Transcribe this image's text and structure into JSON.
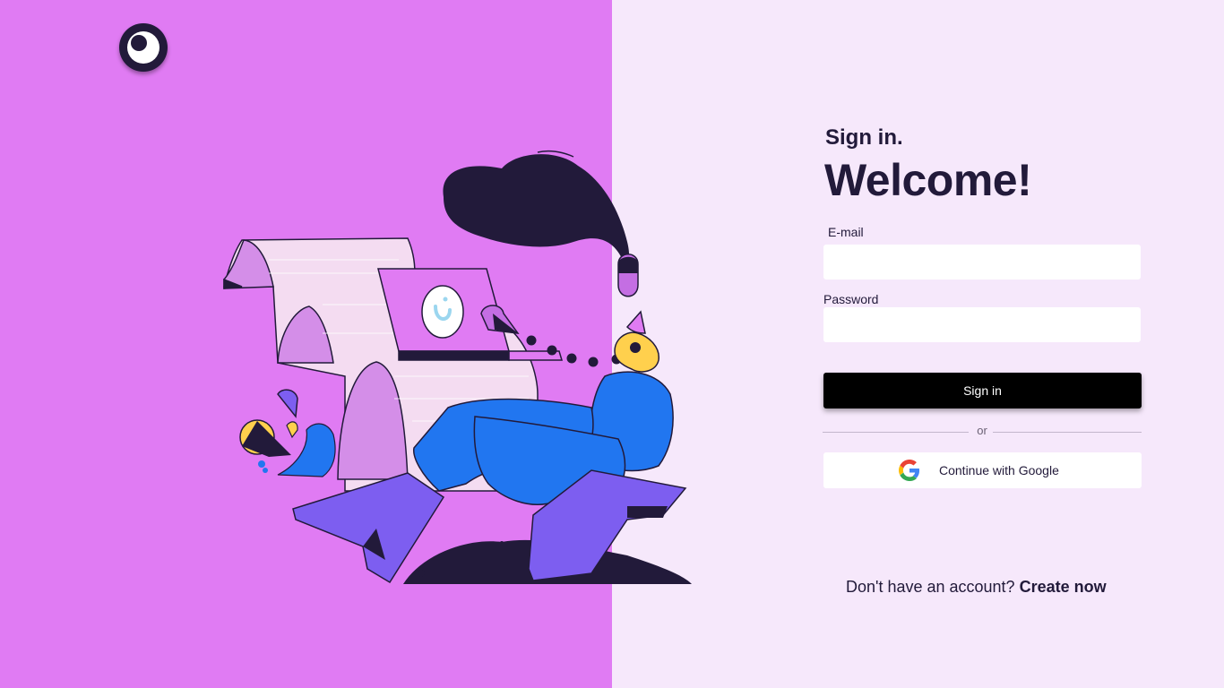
{
  "brand": {
    "logo_icon": "eye-moon-logo-icon"
  },
  "illustration": {
    "name": "person-reading-laptop-illustration"
  },
  "form": {
    "subtitle": "Sign in.",
    "title": "Welcome!",
    "email_label": "E-mail",
    "email_value": "",
    "password_label": "Password",
    "password_value": "",
    "signin_label": "Sign in",
    "divider_text": "or",
    "google_label": "Continue with Google",
    "google_icon": "google-g-icon"
  },
  "footer": {
    "prompt": "Don't have an account?",
    "link": "Create now"
  },
  "colors": {
    "left_bg": "#e07bf3",
    "right_bg": "#f6e8fb",
    "text": "#221a3a",
    "button": "#000000"
  }
}
